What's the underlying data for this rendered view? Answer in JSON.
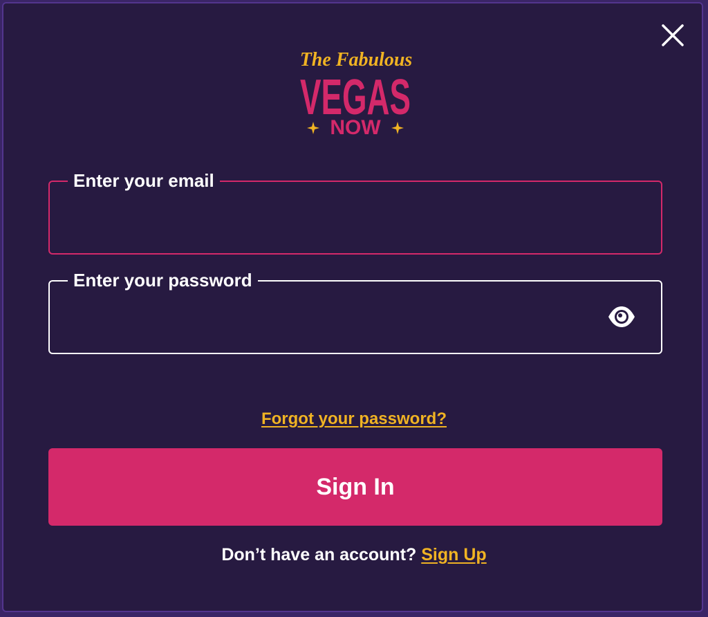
{
  "colors": {
    "background": "#271a41",
    "accent_pink": "#d4296a",
    "accent_gold": "#f0b323",
    "text": "#ffffff"
  },
  "logo": {
    "line1": "The Fabulous",
    "line2": "VEGAS",
    "line3": "NOW"
  },
  "close_icon": "close-icon",
  "email": {
    "label": "Enter your email",
    "value": "",
    "placeholder": ""
  },
  "password": {
    "label": "Enter your password",
    "value": "",
    "placeholder": "",
    "toggle_icon": "eye-icon"
  },
  "forgot_link": "Forgot your password?",
  "sign_in_label": "Sign In",
  "signup": {
    "prompt": "Don’t have an account?",
    "link": "Sign Up"
  }
}
